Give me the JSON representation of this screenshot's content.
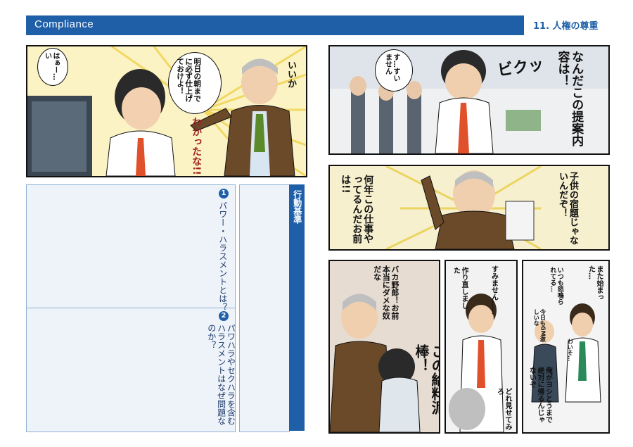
{
  "header": {
    "title": "Compliance",
    "section": "11. 人権の尊重"
  },
  "panel_top_left": {
    "boss_line": "明日の朝までに必ず仕上げておけよ！",
    "boss_iika": "いいか",
    "boss_wakatta": "わかったな!!",
    "employee": "はぁー…い"
  },
  "panel_right_1": {
    "boss": "なんだこの提案内容は！",
    "sfx": "ビクッ",
    "employee": "す…すいません"
  },
  "panel_right_2": {
    "boss_a": "子供の宿題じゃないんだぞ！",
    "boss_b": "何年この仕事やってるんだお前は!!"
  },
  "panel_bottom_1": {
    "insult": "バカ野郎！お前本当にダメな奴だな",
    "thief": "この給料泥棒！"
  },
  "panel_bottom_2": {
    "sorry": "すみません……",
    "redo": "作り直しました",
    "show": "どれ見せてみろ"
  },
  "panel_bottom_3": {
    "again": "また始まった…",
    "always": "いつも怒鳴られてる…",
    "gm": "今日もGM激しいな",
    "whisper": "わいそ…",
    "vow": "俺がヨシとうまで絶対に帰るんじゃないぞ"
  },
  "guidelines": {
    "title": "行動基準",
    "q1_num": "1",
    "q1": "パワー・ハラスメントとは？",
    "q2_num": "2",
    "q2": "パワハラやセクハラを含むハラスメントはなぜ問題なのか？"
  },
  "colors": {
    "accent": "#1e5fa8",
    "box_fill": "#eef3f9",
    "box_border": "#8fb0d4",
    "burst": "#f3e25a"
  }
}
